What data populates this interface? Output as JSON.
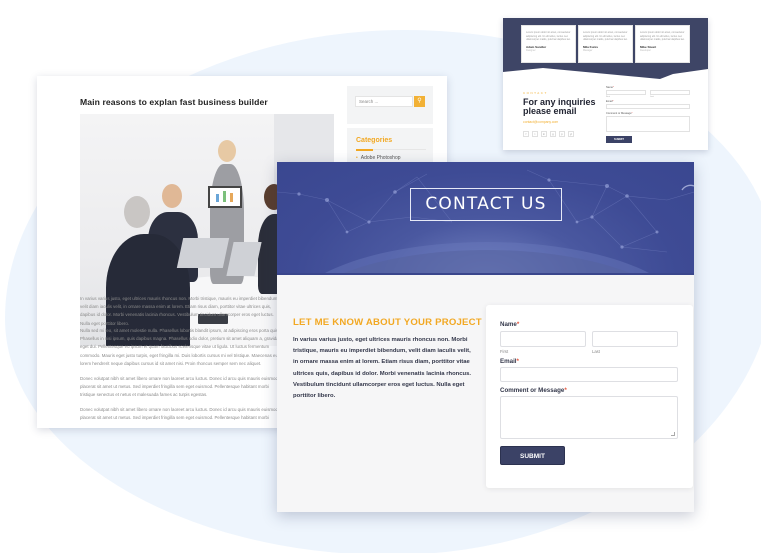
{
  "colors": {
    "accent": "#f2a823",
    "navy": "#3b4266",
    "hero_blue": "#3e4b95",
    "background_blob": "#eef5fd"
  },
  "blog_page": {
    "title": "Main reasons to explan fast business builder",
    "image_alt": "business-meeting-photo",
    "search": {
      "placeholder": "Search ...",
      "icon": "search-icon"
    },
    "categories": {
      "title": "Categories",
      "items": [
        "Adobe Photoshop"
      ]
    },
    "paragraphs": [
      "In varius varius justo, eget ultrices mauris rhoncus non. Morbi tristique, mauris eu imperdiet bibendum, velit diam iaculis velit, in ornare massa enim at lorem. Etiam risus diam, porttitor vitae ultrices quis, dapibus id dolor. Morbi venenatis lacinia rhoncus. Vestibulum tincidunt ullamcorper eros eget luctus. Nulla eget porttitor libero.",
      "Nulla sed mi leo, sit amet molestie nulla. Phasellus lobortis blandit ipsum, at adipiscing eros porta quis. Phasellus in nisi ipsum, quis dapibus magna. Phasellus odio dolor, pretium sit amet aliquam a, gravida eget dui. Pellentesque eu ipsum et quam faucibus scelerisque vitae ut ligula. Ut luctus fermentum commodo. Mauris eget justo turpis, eget fringilla mi. Duis lobortis cursus mi vel tristique. Maecenas eu lorem hendrerit neque dapibus cursus id sit amet nisi. Proin rhoncus semper sem nec aliquet.",
      "Donec volutpat nibh sit amet libero ornare non laoreet arcu luctus. Donec id arcu quis mauris euismod placerat sit amet ut metus. Sed imperdiet fringilla sem eget euismod. Pellentesque habitant morbi tristique senectus et netus et malesuada fames ac turpis egestas.",
      "Donec volutpat nibh sit amet libero ornare non laoreet arcu luctus. Donec id arcu quis mauris euismod placerat sit amet ut metus. Sed imperdiet fringilla sem eget euismod. Pellentesque habitant morbi"
    ]
  },
  "mini_page": {
    "testimonials": [
      {
        "text": "Lorem ipsum dolor sit amet, consectetur adipiscing elit. Ut elit tellus, luctus nec ullamcorper mattis, pulvinar dapibus leo.",
        "name": "Adam Sandler",
        "role": "Designer"
      },
      {
        "text": "Lorem ipsum dolor sit amet, consectetur adipiscing elit. Ut elit tellus, luctus nec ullamcorper mattis, pulvinar dapibus leo.",
        "name": "Mila Kunis",
        "role": "Manager"
      },
      {
        "text": "Lorem ipsum dolor sit amet, consectetur adipiscing elit. Ut elit tellus, luctus nec ullamcorper mattis, pulvinar dapibus leo.",
        "name": "Mike Stuart",
        "role": "Developer"
      }
    ],
    "kicker": "CONTACT",
    "heading": "For any inquiries please email",
    "email": "contact@company.com",
    "social_icons": [
      "f",
      "t",
      "in",
      "g",
      "p",
      "yt"
    ],
    "form": {
      "name_label": "Name",
      "first_label": "First",
      "last_label": "Last",
      "email_label": "Email",
      "message_label": "Comment or Message",
      "required_mark": "*",
      "submit": "SUBMIT"
    }
  },
  "main_page": {
    "hero_title": "CONTACT US",
    "heading": "LET ME KNOW ABOUT YOUR PROJECT",
    "paragraph": "In varius varius justo, eget ultrices mauris rhoncus non. Morbi tristique, mauris eu imperdiet bibendum, velit diam iaculis velit, in ornare massa enim at lorem. Etiam risus diam, porttitor vitae ultrices quis, dapibus id dolor. Morbi venenatis lacinia rhoncus. Vestibulum tincidunt ullamcorper eros eget luctus. Nulla eget porttitor libero.",
    "form": {
      "name_label": "Name",
      "first_label": "First",
      "last_label": "Last",
      "email_label": "Email",
      "message_label": "Comment or Message",
      "required_mark": "*",
      "submit": "SUBMIT"
    }
  }
}
